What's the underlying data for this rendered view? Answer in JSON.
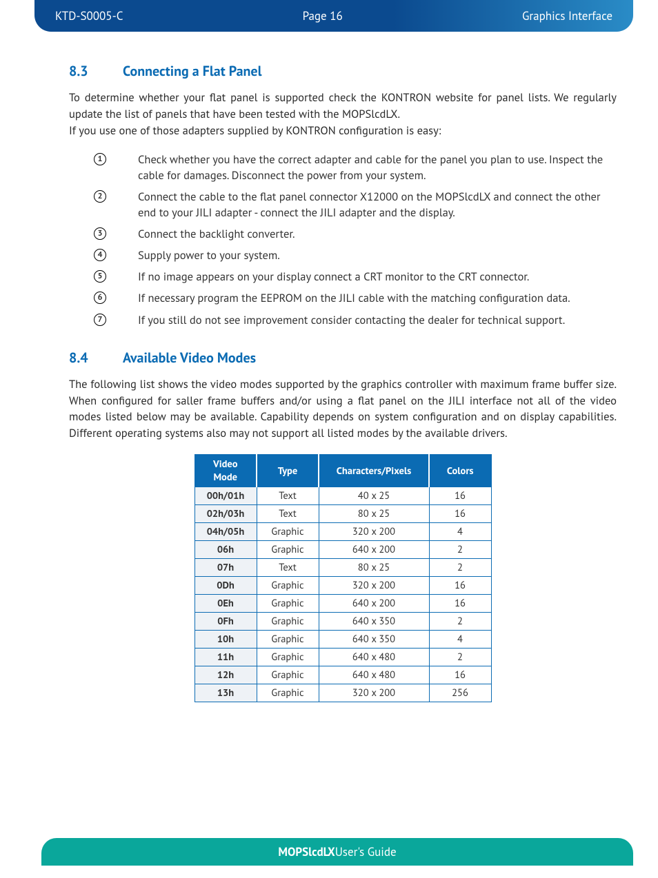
{
  "header": {
    "doc_id": "KTD-S0005-C",
    "page": "Page 16",
    "section": "Graphics Interface"
  },
  "section83": {
    "num": "8.3",
    "title": "Connecting a Flat Panel",
    "para1": "To determine whether your flat panel is supported check the KONTRON website for panel lists. We regularly update the list of panels that have been tested with the MOPSlcdLX.",
    "para2": "If you use one of those adapters supplied by KONTRON configuration is easy:",
    "steps": [
      "Check whether you have the correct adapter and cable for the panel you plan to use. Inspect the cable for damages. Disconnect the power from your system.",
      "Connect the cable to the flat panel connector X12000 on the MOPSlcdLX and connect the other end to your JILI adapter - connect the JILI adapter and the display.",
      "Connect the backlight converter.",
      "Supply power to your system.",
      "If no image appears on your display connect a CRT monitor to the CRT connector.",
      "If necessary program the EEPROM on the JILI cable with the matching configuration data.",
      "If you still do not see improvement consider contacting the dealer for technical support."
    ]
  },
  "section84": {
    "num": "8.4",
    "title": "Available Video Modes",
    "para": "The following list shows the video modes supported by the graphics controller with maximum frame buffer size. When configured for saller frame buffers and/or using a flat panel on the JILI interface not all of the video modes listed below may be available. Capability depends on system configuration and on display capabilities. Different operating systems also may not support all listed modes by the available drivers.",
    "table": {
      "headers": [
        "Video Mode",
        "Type",
        "Characters/Pixels",
        "Colors"
      ],
      "rows": [
        {
          "mode": "00h/01h",
          "type": "Text",
          "cp": "40 x 25",
          "colors": "16"
        },
        {
          "mode": "02h/03h",
          "type": "Text",
          "cp": "80 x 25",
          "colors": "16"
        },
        {
          "mode": "04h/05h",
          "type": "Graphic",
          "cp": "320 x 200",
          "colors": "4"
        },
        {
          "mode": "06h",
          "type": "Graphic",
          "cp": "640 x 200",
          "colors": "2"
        },
        {
          "mode": "07h",
          "type": "Text",
          "cp": "80 x 25",
          "colors": "2"
        },
        {
          "mode": "0Dh",
          "type": "Graphic",
          "cp": "320 x 200",
          "colors": "16"
        },
        {
          "mode": "0Eh",
          "type": "Graphic",
          "cp": "640 x 200",
          "colors": "16"
        },
        {
          "mode": "0Fh",
          "type": "Graphic",
          "cp": "640 x 350",
          "colors": "2"
        },
        {
          "mode": "10h",
          "type": "Graphic",
          "cp": "640 x 350",
          "colors": "4"
        },
        {
          "mode": "11h",
          "type": "Graphic",
          "cp": "640 x 480",
          "colors": "2"
        },
        {
          "mode": "12h",
          "type": "Graphic",
          "cp": "640 x 480",
          "colors": "16"
        },
        {
          "mode": "13h",
          "type": "Graphic",
          "cp": "320 x 200",
          "colors": "256"
        }
      ]
    }
  },
  "footer": {
    "product": "MOPSlcdLX",
    "suffix": " User's Guide"
  }
}
